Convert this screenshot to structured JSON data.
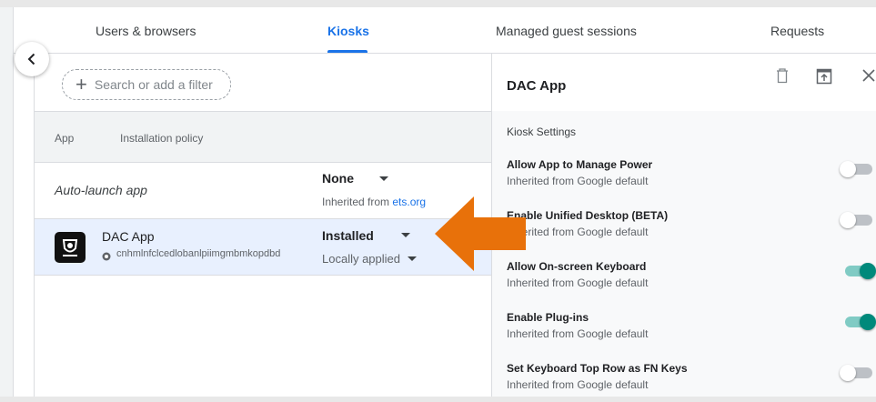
{
  "tabs": [
    {
      "label": "Users & browsers",
      "active": false
    },
    {
      "label": "Kiosks",
      "active": true
    },
    {
      "label": "Managed guest sessions",
      "active": false
    },
    {
      "label": "Requests",
      "active": false
    }
  ],
  "search": {
    "placeholder": "Search or add a filter"
  },
  "table": {
    "headers": {
      "app": "App",
      "policy": "Installation policy"
    },
    "autolaunch": {
      "label": "Auto-launch app",
      "value": "None",
      "inherited_prefix": "Inherited from ",
      "inherited_org": "ets.org"
    },
    "apps": [
      {
        "name": "DAC App",
        "id": "cnhmlnfclcedlobanlpiimgmbmkopdbd",
        "policy": "Installed",
        "applied": "Locally applied"
      }
    ]
  },
  "panel": {
    "title": "DAC App",
    "section": "Kiosk Settings",
    "settings": [
      {
        "name": "Allow App to Manage Power",
        "inherited": "Inherited from Google default",
        "enabled": false
      },
      {
        "name": "Enable Unified Desktop (BETA)",
        "inherited": "Inherited from Google default",
        "enabled": false
      },
      {
        "name": "Allow On-screen Keyboard",
        "inherited": "Inherited from Google default",
        "enabled": true
      },
      {
        "name": "Enable Plug-ins",
        "inherited": "Inherited from Google default",
        "enabled": true
      },
      {
        "name": "Set Keyboard Top Row as FN Keys",
        "inherited": "Inherited from Google default",
        "enabled": false
      }
    ]
  },
  "colors": {
    "accent": "#1a73e8",
    "toggle_on": "#00897b",
    "arrow": "#e8710a",
    "selected_row": "#e8f0fe"
  }
}
